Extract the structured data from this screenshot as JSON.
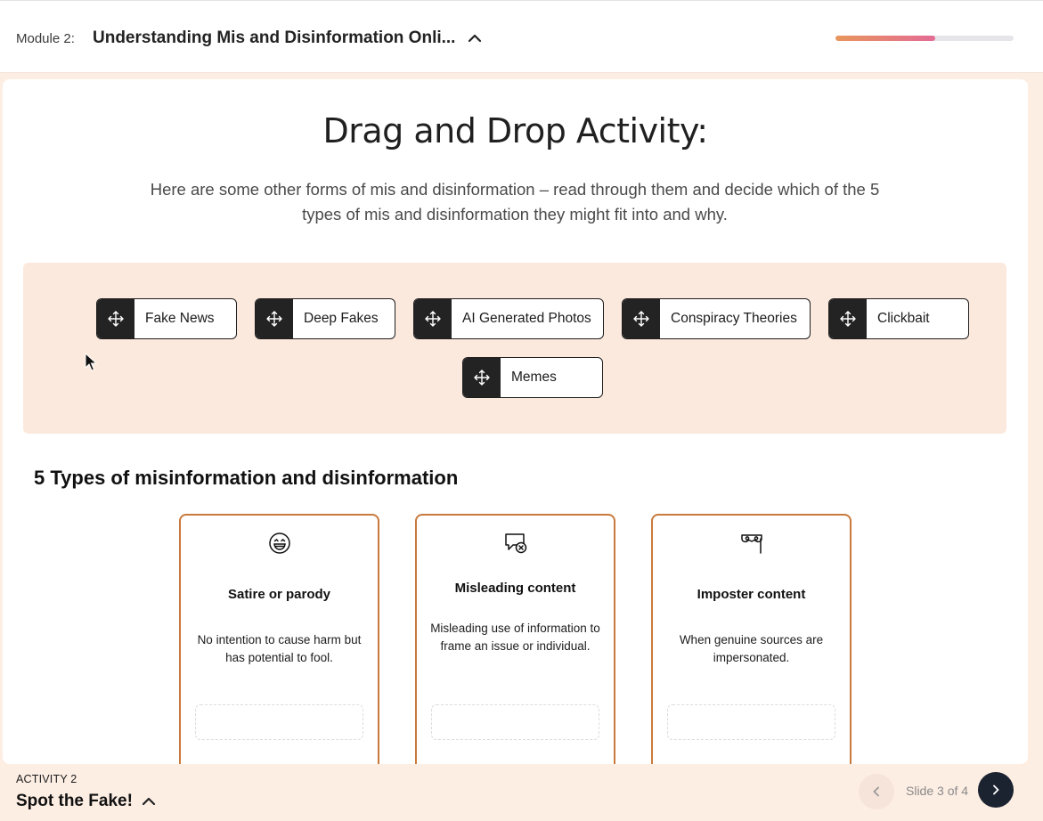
{
  "header": {
    "module_label": "Module 2:",
    "module_title": "Understanding Mis and Disinformation Onli...",
    "progress_fraction": 0.56
  },
  "activity": {
    "title": "Drag and Drop Activity:",
    "instructions": "Here are some other forms of mis and disinformation – read through them and decide which of the 5 types of mis and disinformation they might fit into and why."
  },
  "chips": [
    {
      "label": "Fake News",
      "icon": "move-icon"
    },
    {
      "label": "Deep Fakes",
      "icon": "move-icon"
    },
    {
      "label": "AI Generated Photos",
      "icon": "move-icon"
    },
    {
      "label": "Conspiracy Theories",
      "icon": "move-icon"
    },
    {
      "label": "Clickbait",
      "icon": "move-icon"
    },
    {
      "label": "Memes",
      "icon": "move-icon"
    }
  ],
  "types_section": {
    "title": "5 Types of misinformation and disinformation",
    "cards": [
      {
        "icon": "laughing-face-icon",
        "title": "Satire or parody",
        "description": "No intention to cause harm but has potential to fool."
      },
      {
        "icon": "speech-bubble-x-icon",
        "title": "Misleading content",
        "description": "Misleading use of information to frame an issue or individual."
      },
      {
        "icon": "mask-icon",
        "title": "Imposter content",
        "description": "When genuine sources are impersonated."
      }
    ]
  },
  "footer": {
    "eyebrow": "ACTIVITY 2",
    "title": "Spot the Fake!",
    "slide_counter": "Slide 3 of 4"
  },
  "colors": {
    "accent_orange": "#c97a3c",
    "drag_zone_bg": "#fce9dd",
    "chip_handle": "#232323",
    "next_button": "#1b2330"
  }
}
